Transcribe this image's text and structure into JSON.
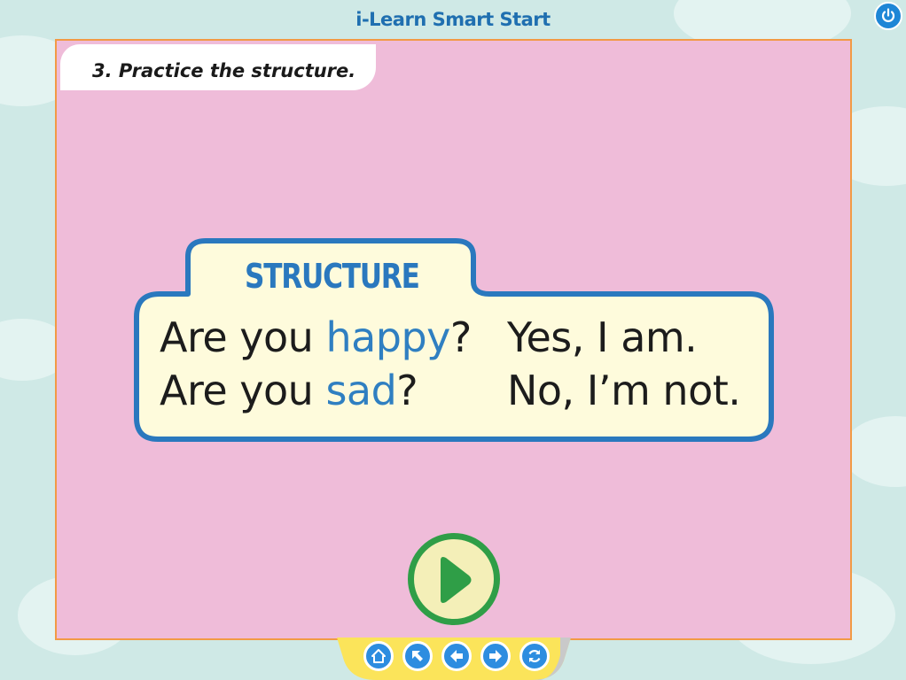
{
  "app": {
    "title": "i-Learn Smart Start"
  },
  "instruction": "3. Practice the structure.",
  "structure": {
    "heading": "STRUCTURE",
    "rows": [
      {
        "q_prefix": "Are you ",
        "q_word": "happy",
        "q_suffix": "?",
        "answer": "Yes, I am."
      },
      {
        "q_prefix": "Are you ",
        "q_word": "sad",
        "q_suffix": "?",
        "answer": "No, I’m not."
      }
    ]
  },
  "controls": {
    "play_icon": "play-icon",
    "power_icon": "power-icon",
    "nav": [
      "home-icon",
      "arrow-up-left-icon",
      "arrow-left-icon",
      "arrow-right-icon",
      "refresh-icon"
    ]
  },
  "colors": {
    "board_bg": "#efbcd9",
    "board_border": "#f29a45",
    "structure_frame": "#2a78be",
    "structure_fill": "#fefbdc",
    "highlight_word": "#2f7fc1",
    "play_ring": "#2f9e47",
    "nav_button": "#2d8de0",
    "nav_bar": "#fbe45a"
  }
}
